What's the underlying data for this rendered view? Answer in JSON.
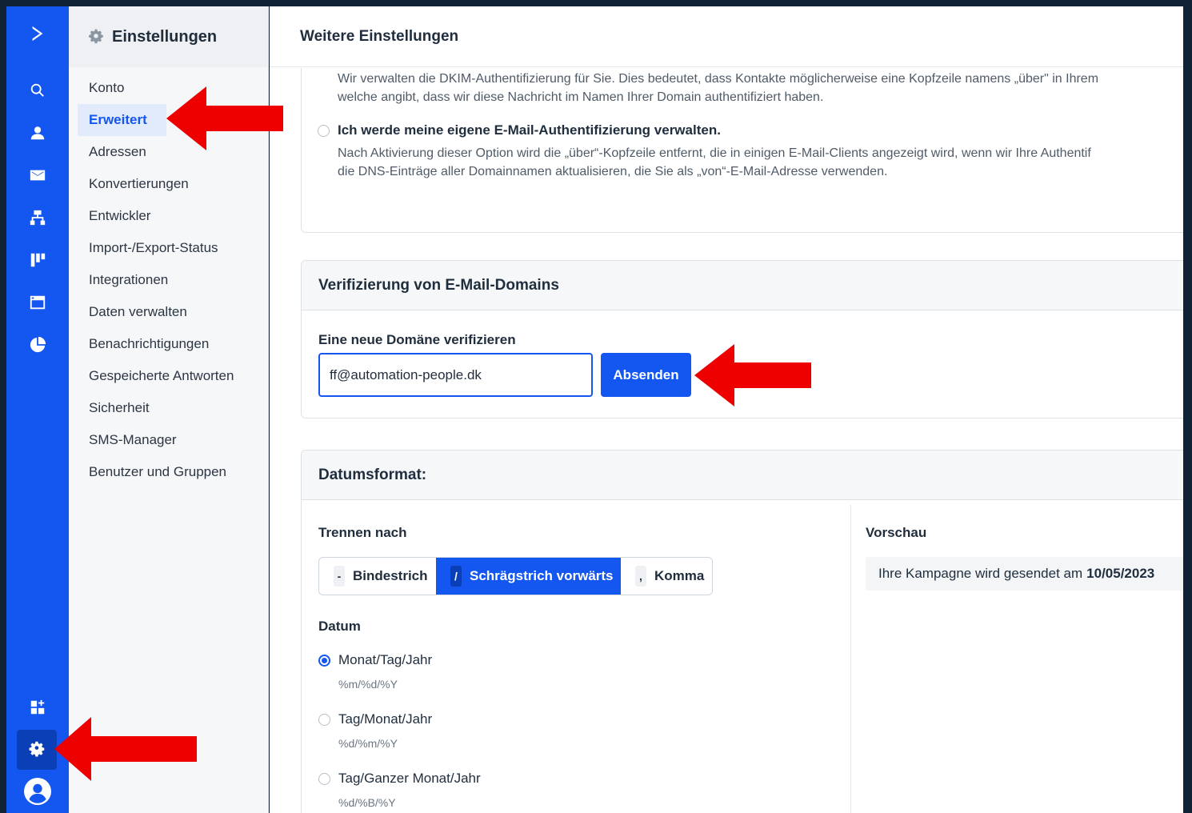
{
  "rail": {
    "icons": [
      "logo-icon",
      "search-icon",
      "contacts-icon",
      "email-icon",
      "automation-icon",
      "pipeline-icon",
      "site-icon",
      "reports-icon",
      "apps-icon",
      "settings-icon",
      "profile-icon"
    ]
  },
  "sidebar": {
    "title": "Einstellungen",
    "items": [
      {
        "label": "Konto"
      },
      {
        "label": "Erweitert"
      },
      {
        "label": "Adressen"
      },
      {
        "label": "Konvertierungen"
      },
      {
        "label": "Entwickler"
      },
      {
        "label": "Import-/Export-Status"
      },
      {
        "label": "Integrationen"
      },
      {
        "label": "Daten verwalten"
      },
      {
        "label": "Benachrichtigungen"
      },
      {
        "label": "Gespeicherte Antworten"
      },
      {
        "label": "Sicherheit"
      },
      {
        "label": "SMS-Manager"
      },
      {
        "label": "Benutzer und Gruppen"
      }
    ],
    "active_index": 1
  },
  "header": {
    "title": "Weitere Einstellungen"
  },
  "dkim": {
    "line1": "Wir verwalten die DKIM-Authentifizierung für Sie. Dies bedeutet, dass Kontakte möglicherweise eine Kopfzeile namens „über\" in Ihrem",
    "line2": "welche angibt, dass wir diese Nachricht im Namen Ihrer Domain authentifiziert haben.",
    "own_label": "Ich werde meine eigene E-Mail-Authentifizierung verwalten.",
    "own_desc1": "Nach Aktivierung dieser Option wird die „über“-Kopfzeile entfernt, die in einigen E-Mail-Clients angezeigt wird, wenn wir Ihre Authentif",
    "own_desc2": "die DNS-Einträge aller Domainnamen aktualisieren, die Sie als „von“-E-Mail-Adresse verwenden."
  },
  "domain": {
    "title": "Verifizierung von E-Mail-Domains",
    "label": "Eine neue Domäne verifizieren",
    "value": "ff@automation-people.dk",
    "submit": "Absenden"
  },
  "date_format": {
    "title": "Datumsformat:",
    "separator_label": "Trennen nach",
    "separators": [
      {
        "key": "-",
        "label": "Bindestrich"
      },
      {
        "key": "/",
        "label": "Schrägstrich vorwärts"
      },
      {
        "key": ",",
        "label": "Komma"
      }
    ],
    "active_separator": 1,
    "date_label": "Datum",
    "options": [
      {
        "label": "Monat/Tag/Jahr",
        "format": "%m/%d/%Y"
      },
      {
        "label": "Tag/Monat/Jahr",
        "format": "%d/%m/%Y"
      },
      {
        "label": "Tag/Ganzer Monat/Jahr",
        "format": "%d/%B/%Y"
      }
    ],
    "selected_option": 0,
    "preview_label": "Vorschau",
    "preview_text": "Ihre Kampagne wird gesendet am",
    "preview_date": "10/05/2023"
  },
  "colors": {
    "accent": "#1356f0",
    "annotation": "#ee0000",
    "frame": "#0f2233"
  }
}
